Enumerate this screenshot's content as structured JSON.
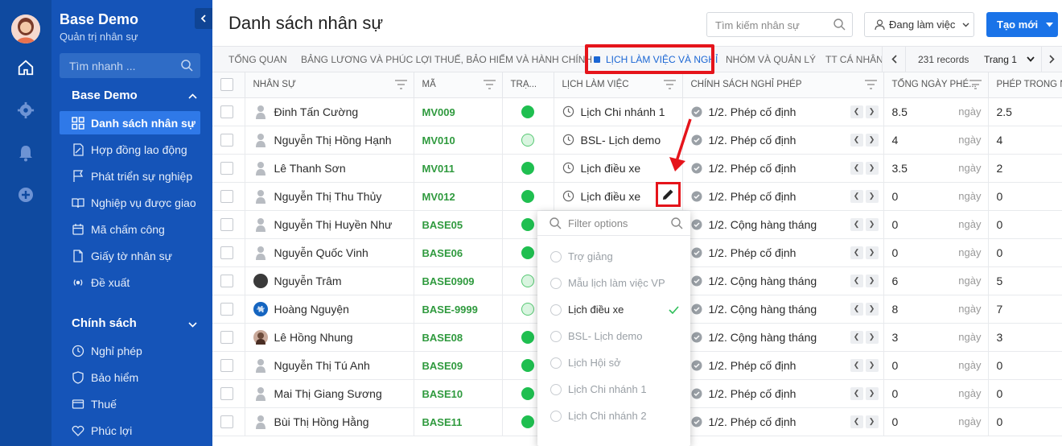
{
  "sidebar": {
    "brand_title": "Base Demo",
    "brand_sub": "Quản trị nhân sự",
    "search_placeholder": "Tìm nhanh ...",
    "section1": "Base Demo",
    "section2": "Chính sách",
    "items": [
      {
        "label": "Danh sách nhân sự",
        "icon": "grid-icon"
      },
      {
        "label": "Hợp đồng lao động",
        "icon": "contract-icon"
      },
      {
        "label": "Phát triển sự nghiệp",
        "icon": "flag-icon"
      },
      {
        "label": "Nghiệp vụ được giao",
        "icon": "book-icon"
      },
      {
        "label": "Mã chấm công",
        "icon": "calendar-icon"
      },
      {
        "label": "Giấy tờ nhân sự",
        "icon": "document-icon"
      },
      {
        "label": "Đề xuất",
        "icon": "broadcast-icon"
      }
    ],
    "policy_items": [
      {
        "label": "Nghỉ phép",
        "icon": "clock-icon"
      },
      {
        "label": "Bảo hiểm",
        "icon": "shield-icon"
      },
      {
        "label": "Thuế",
        "icon": "card-icon"
      },
      {
        "label": "Phúc lợi",
        "icon": "heart-icon"
      }
    ]
  },
  "header": {
    "title": "Danh sách nhân sự",
    "search_placeholder": "Tìm kiếm nhân sự",
    "status_filter": "Đang làm việc",
    "create_label": "Tạo mới"
  },
  "tabs": [
    "TỔNG QUAN",
    "BẢNG LƯƠNG VÀ PHÚC LỢI",
    "THUẾ, BẢO HIỂM VÀ HÀNH CHÍNH",
    "LỊCH LÀM VIỆC VÀ NGHỈ",
    "NHÓM VÀ QUẢN LÝ",
    "TT CÁ NHÂN"
  ],
  "pager": {
    "records": "231 records",
    "page": "Trang 1"
  },
  "columns": [
    "NHÂN SỰ",
    "MÃ",
    "TRẠ...",
    "LỊCH LÀM VIỆC",
    "CHÍNH SÁCH NGHỈ PHÉP",
    "TỔNG NGÀY PHÉ...",
    "PHÉP TRONG NĂ"
  ],
  "unit_label": "ngày",
  "rows": [
    {
      "name": "Đinh Tấn Cường",
      "code": "MV009",
      "status": "on",
      "schedule": "Lịch Chi nhánh 1",
      "policy": "1/2. Phép cố định",
      "total": "8.5",
      "year": "2.5",
      "avatar": "person"
    },
    {
      "name": "Nguyễn Thị Hồng Hạnh",
      "code": "MV010",
      "status": "off",
      "schedule": "BSL- Lịch demo",
      "policy": "1/2. Phép cố định",
      "total": "4",
      "year": "4",
      "avatar": "person"
    },
    {
      "name": "Lê Thanh Sơn",
      "code": "MV011",
      "status": "on",
      "schedule": "Lịch điều xe",
      "policy": "1/2. Phép cố định",
      "total": "3.5",
      "year": "2",
      "avatar": "person"
    },
    {
      "name": "Nguyễn Thị Thu Thủy",
      "code": "MV012",
      "status": "on",
      "schedule": "Lịch điều xe",
      "policy": "1/2. Phép cố định",
      "total": "0",
      "year": "0",
      "avatar": "person"
    },
    {
      "name": "Nguyễn Thị Huyền Như",
      "code": "BASE05",
      "status": "on",
      "schedule": "",
      "policy": "1/2. Cộng hàng tháng",
      "total": "0",
      "year": "0",
      "avatar": "person"
    },
    {
      "name": "Nguyễn Quốc Vinh",
      "code": "BASE06",
      "status": "on",
      "schedule": "",
      "policy": "1/2. Phép cố định",
      "total": "0",
      "year": "0",
      "avatar": "person"
    },
    {
      "name": "Nguyễn Trâm",
      "code": "BASE0909",
      "status": "off",
      "schedule": "",
      "policy": "1/2. Cộng hàng tháng",
      "total": "6",
      "year": "5",
      "avatar": "dark"
    },
    {
      "name": "Hoàng Nguyện",
      "code": "BASE-9999",
      "status": "off",
      "schedule": "",
      "policy": "1/2. Cộng hàng tháng",
      "total": "8",
      "year": "7",
      "avatar": "blue"
    },
    {
      "name": "Lê Hồng Nhung",
      "code": "BASE08",
      "status": "on",
      "schedule": "",
      "policy": "1/2. Cộng hàng tháng",
      "total": "3",
      "year": "3",
      "avatar": "photo"
    },
    {
      "name": "Nguyễn Thị Tú Anh",
      "code": "BASE09",
      "status": "on",
      "schedule": "",
      "policy": "1/2. Phép cố định",
      "total": "0",
      "year": "0",
      "avatar": "person"
    },
    {
      "name": "Mai Thị Giang Sương",
      "code": "BASE10",
      "status": "on",
      "schedule": "",
      "policy": "1/2. Phép cố định",
      "total": "0",
      "year": "0",
      "avatar": "person"
    },
    {
      "name": "Bùi Thị Hồng Hằng",
      "code": "BASE11",
      "status": "on",
      "schedule": "",
      "policy": "1/2. Phép cố định",
      "total": "0",
      "year": "0",
      "avatar": "person"
    }
  ],
  "dropdown": {
    "placeholder": "Filter options",
    "options": [
      {
        "label": "Trợ giảng",
        "selected": false
      },
      {
        "label": "Mẫu lịch làm việc VP",
        "selected": false
      },
      {
        "label": "Lịch điều xe",
        "selected": true
      },
      {
        "label": "BSL- Lịch demo",
        "selected": false
      },
      {
        "label": "Lịch Hội sở",
        "selected": false
      },
      {
        "label": "Lịch Chi nhánh 1",
        "selected": false
      },
      {
        "label": "Lịch Chi nhánh 2",
        "selected": false
      }
    ]
  },
  "colors": {
    "sidebar": "#1554b8",
    "rail": "#0f4aa0",
    "accent": "#1a73e8",
    "highlight": "#e5141b",
    "status_green": "#1fbf50",
    "code_green": "#2f9a3e"
  }
}
